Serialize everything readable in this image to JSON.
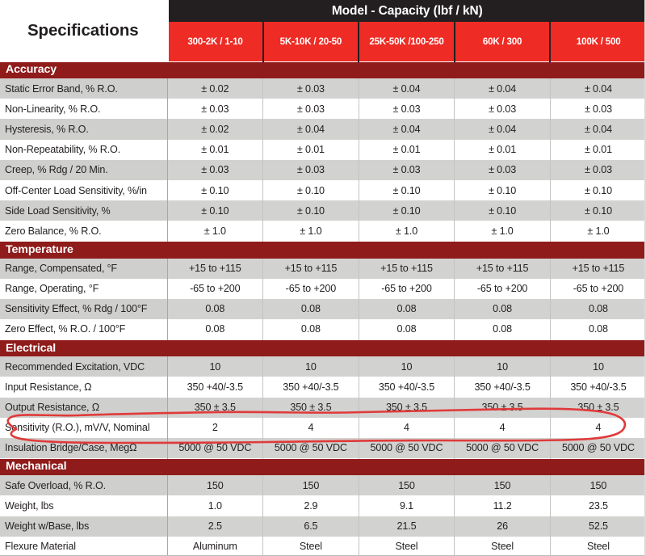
{
  "header": {
    "spec_title": "Specifications",
    "model_band": "Model - Capacity (lbf / kN)",
    "columns": [
      "300-2K / 1-10",
      "5K-10K / 20-50",
      "25K-50K /100-250",
      "60K / 300",
      "100K / 500"
    ]
  },
  "colors": {
    "band_dark": "#231f20",
    "header_red": "#ee2b24",
    "section_red": "#8f1b1b",
    "row_gray": "#d2d2d0",
    "row_white": "#ffffff",
    "annotation_red": "#e03a3a"
  },
  "annotation": {
    "type": "hand-drawn-ellipse",
    "target_row": "Sensitivity (R.O.), mV/V, Nominal",
    "color": "#e03a3a"
  },
  "sections": [
    {
      "name": "Accuracy",
      "rows": [
        {
          "label": "Static Error Band, % R.O.",
          "values": [
            "± 0.02",
            "± 0.03",
            "± 0.04",
            "± 0.04",
            "± 0.04"
          ]
        },
        {
          "label": "Non-Linearity, % R.O.",
          "values": [
            "± 0.03",
            "± 0.03",
            "± 0.03",
            "± 0.03",
            "± 0.03"
          ]
        },
        {
          "label": "Hysteresis, % R.O.",
          "values": [
            "± 0.02",
            "± 0.04",
            "± 0.04",
            "± 0.04",
            "± 0.04"
          ]
        },
        {
          "label": "Non-Repeatability, % R.O.",
          "values": [
            "± 0.01",
            "± 0.01",
            "± 0.01",
            "± 0.01",
            "± 0.01"
          ]
        },
        {
          "label": "Creep, % Rdg / 20 Min.",
          "values": [
            "± 0.03",
            "± 0.03",
            "± 0.03",
            "± 0.03",
            "± 0.03"
          ]
        },
        {
          "label": "Off-Center Load Sensitivity, %/in",
          "values": [
            "± 0.10",
            "± 0.10",
            "± 0.10",
            "± 0.10",
            "± 0.10"
          ]
        },
        {
          "label": "Side Load Sensitivity, %",
          "values": [
            "± 0.10",
            "± 0.10",
            "± 0.10",
            "± 0.10",
            "± 0.10"
          ]
        },
        {
          "label": "Zero Balance, % R.O.",
          "values": [
            "± 1.0",
            "± 1.0",
            "± 1.0",
            "± 1.0",
            "± 1.0"
          ]
        }
      ]
    },
    {
      "name": "Temperature",
      "rows": [
        {
          "label": "Range, Compensated, °F",
          "values": [
            "+15 to +115",
            "+15 to +115",
            "+15 to +115",
            "+15 to +115",
            "+15 to +115"
          ]
        },
        {
          "label": "Range, Operating, °F",
          "values": [
            "-65 to +200",
            "-65 to +200",
            "-65 to +200",
            "-65 to +200",
            "-65 to +200"
          ]
        },
        {
          "label": "Sensitivity Effect, % Rdg / 100°F",
          "values": [
            "0.08",
            "0.08",
            "0.08",
            "0.08",
            "0.08"
          ]
        },
        {
          "label": "Zero Effect, % R.O. / 100°F",
          "values": [
            "0.08",
            "0.08",
            "0.08",
            "0.08",
            "0.08"
          ]
        }
      ]
    },
    {
      "name": "Electrical",
      "rows": [
        {
          "label": "Recommended Excitation, VDC",
          "values": [
            "10",
            "10",
            "10",
            "10",
            "10"
          ]
        },
        {
          "label": "Input Resistance, Ω",
          "values": [
            "350 +40/-3.5",
            "350 +40/-3.5",
            "350 +40/-3.5",
            "350 +40/-3.5",
            "350 +40/-3.5"
          ]
        },
        {
          "label": "Output Resistance, Ω",
          "values": [
            "350 ± 3.5",
            "350 ± 3.5",
            "350 ± 3.5",
            "350 ± 3.5",
            "350 ± 3.5"
          ]
        },
        {
          "label": "Sensitivity (R.O.), mV/V, Nominal",
          "values": [
            "2",
            "4",
            "4",
            "4",
            "4"
          ],
          "highlighted": true
        },
        {
          "label": "Insulation Bridge/Case, MegΩ",
          "values": [
            "5000 @ 50 VDC",
            "5000 @ 50 VDC",
            "5000 @ 50 VDC",
            "5000 @ 50 VDC",
            "5000 @ 50 VDC"
          ]
        }
      ]
    },
    {
      "name": "Mechanical",
      "rows": [
        {
          "label": "Safe Overload, % R.O.",
          "values": [
            "150",
            "150",
            "150",
            "150",
            "150"
          ]
        },
        {
          "label": "Weight, lbs",
          "values": [
            "1.0",
            "2.9",
            "9.1",
            "11.2",
            "23.5"
          ]
        },
        {
          "label": "Weight w/Base, lbs",
          "values": [
            "2.5",
            "6.5",
            "21.5",
            "26",
            "52.5"
          ]
        },
        {
          "label": "Flexure Material",
          "values": [
            "Aluminum",
            "Steel",
            "Steel",
            "Steel",
            "Steel"
          ]
        }
      ]
    }
  ]
}
